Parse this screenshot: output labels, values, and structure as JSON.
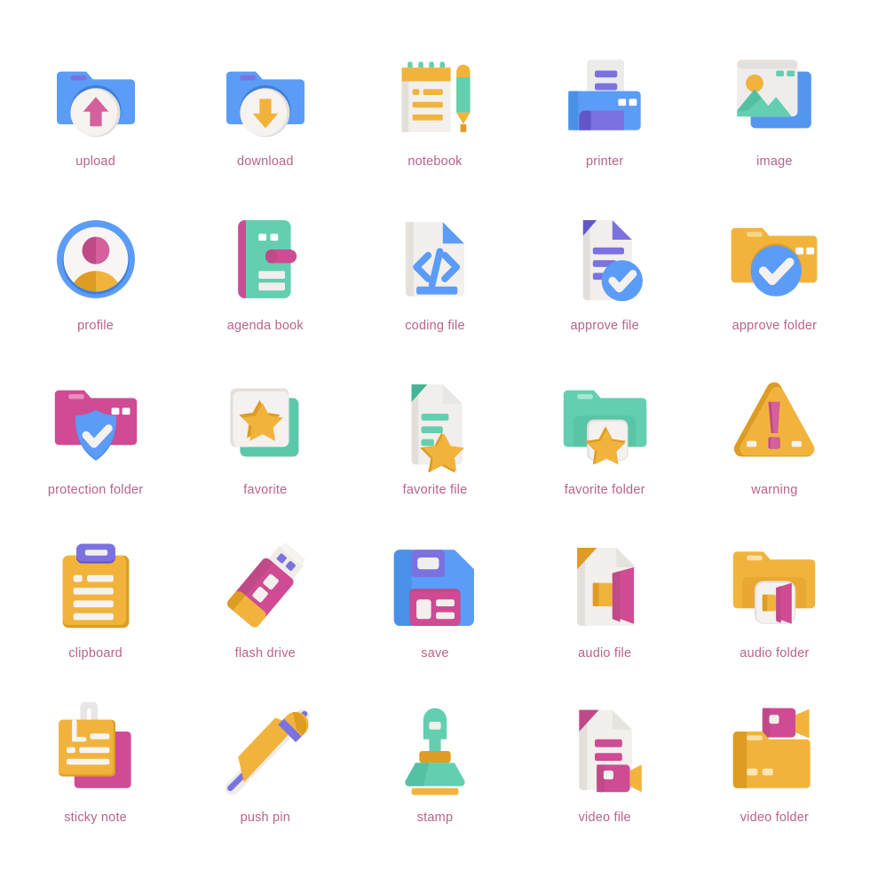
{
  "page": {
    "background_color": "#ffffff",
    "label_color": "#b9628c",
    "grid": {
      "columns": 5,
      "rows": 5,
      "total_icons": 25
    }
  },
  "palette": {
    "blue": "#5b9cf8",
    "blue_dark": "#3f7fd6",
    "blue_mid": "#4a90e8",
    "purple": "#7b72e0",
    "purple_dark": "#6257c9",
    "pink": "#d4609c",
    "pink_dark": "#c04a87",
    "magenta": "#cf4b93",
    "yellow": "#f2b33d",
    "yellow_dark": "#dd9c24",
    "orange": "#e8a32a",
    "teal": "#63cfb0",
    "teal_dark": "#46b496",
    "green_mint": "#6fcfae",
    "paper": "#f2efec",
    "paper_dark": "#e2ded9",
    "white": "#ffffff"
  },
  "icons": [
    {
      "id": "upload",
      "label": "upload",
      "art": "folder-upload"
    },
    {
      "id": "download",
      "label": "download",
      "art": "folder-download"
    },
    {
      "id": "notebook",
      "label": "notebook",
      "art": "notebook"
    },
    {
      "id": "printer",
      "label": "printer",
      "art": "printer"
    },
    {
      "id": "image",
      "label": "image",
      "art": "image"
    },
    {
      "id": "profile",
      "label": "profile",
      "art": "profile"
    },
    {
      "id": "agenda-book",
      "label": "agenda book",
      "art": "agenda-book"
    },
    {
      "id": "coding-file",
      "label": "coding file",
      "art": "coding-file"
    },
    {
      "id": "approve-file",
      "label": "approve file",
      "art": "approve-file"
    },
    {
      "id": "approve-folder",
      "label": "approve folder",
      "art": "approve-folder"
    },
    {
      "id": "protection-folder",
      "label": "protection folder",
      "art": "protection-folder"
    },
    {
      "id": "favorite",
      "label": "favorite",
      "art": "favorite"
    },
    {
      "id": "favorite-file",
      "label": "favorite file",
      "art": "favorite-file"
    },
    {
      "id": "favorite-folder",
      "label": "favorite folder",
      "art": "favorite-folder"
    },
    {
      "id": "warning",
      "label": "warning",
      "art": "warning"
    },
    {
      "id": "clipboard",
      "label": "clipboard",
      "art": "clipboard"
    },
    {
      "id": "flash-drive",
      "label": "flash drive",
      "art": "flash-drive"
    },
    {
      "id": "save",
      "label": "save",
      "art": "save"
    },
    {
      "id": "audio-file",
      "label": "audio file",
      "art": "audio-file"
    },
    {
      "id": "audio-folder",
      "label": "audio folder",
      "art": "audio-folder"
    },
    {
      "id": "sticky-note",
      "label": "sticky note",
      "art": "sticky-note"
    },
    {
      "id": "push-pin",
      "label": "push pin",
      "art": "push-pin"
    },
    {
      "id": "stamp",
      "label": "stamp",
      "art": "stamp"
    },
    {
      "id": "video-file",
      "label": "video file",
      "art": "video-file"
    },
    {
      "id": "video-folder",
      "label": "video folder",
      "art": "video-folder"
    }
  ]
}
